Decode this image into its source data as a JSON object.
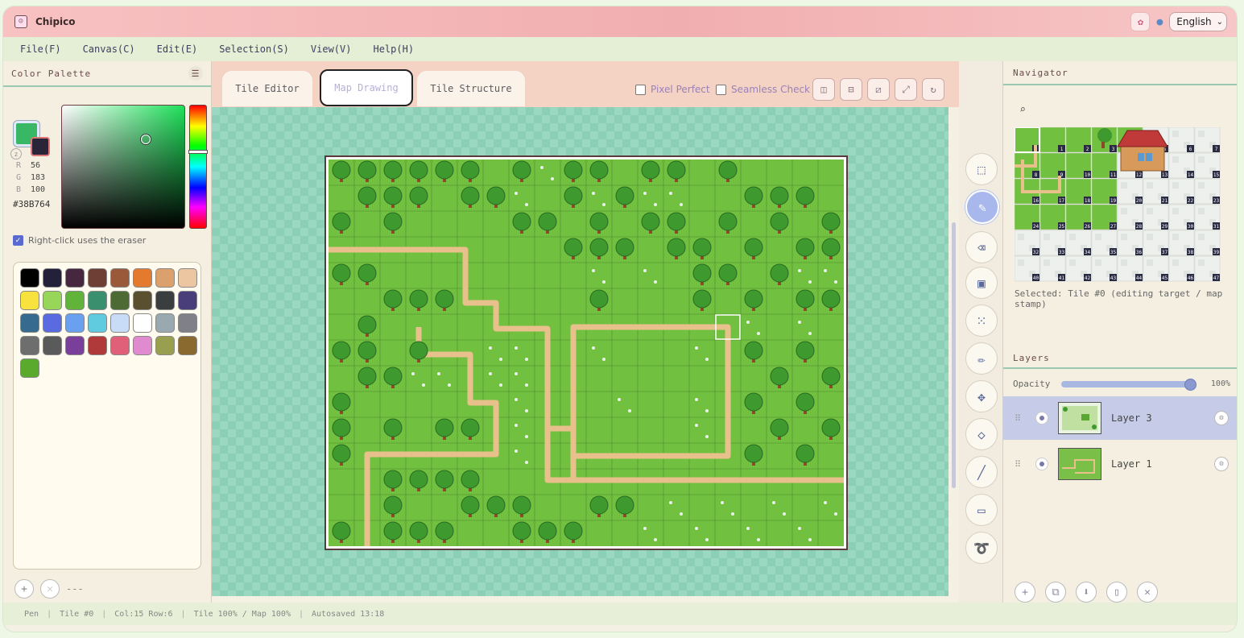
{
  "app": {
    "title": "Chipico",
    "icon": "face-icon",
    "language": "English"
  },
  "menu": [
    "File(F)",
    "Canvas(C)",
    "Edit(E)",
    "Selection(S)",
    "View(V)",
    "Help(H)"
  ],
  "palette_panel": {
    "title": "Color Palette",
    "fg_color": "#38B764",
    "bg_color": "#2a2438",
    "r_label": "R",
    "g_label": "G",
    "b_label": "B",
    "r": "56",
    "g": "183",
    "b": "100",
    "hex": "#38B764",
    "right_click_label": "Right-click uses the eraser",
    "right_click_checked": true,
    "colors": [
      "#000000",
      "#23213a",
      "#47263f",
      "#6e3f34",
      "#9a5a3a",
      "#e37a2e",
      "#dba06c",
      "#ecc6a0",
      "#f7e23e",
      "#98d65a",
      "#62b33a",
      "#3a8f6f",
      "#4e6a34",
      "#5a4f2e",
      "#3a3e3e",
      "#4a3e7a",
      "#366a8e",
      "#5a6ae0",
      "#6aa0f0",
      "#60cadf",
      "#c8dcf7",
      "#ffffff",
      "#9aa8b0",
      "#808088",
      "#6e6e6e",
      "#5a5a5a",
      "#7a3f9a",
      "#b03a3a",
      "#e0607a",
      "#e08ad0",
      "#98a050",
      "#8a6a2e",
      "#5aaa2e"
    ],
    "footer_text": "---"
  },
  "tabs": [
    {
      "label": "Tile Editor",
      "active": false
    },
    {
      "label": "Map Drawing",
      "active": true
    },
    {
      "label": "Tile Structure",
      "active": false
    }
  ],
  "options": {
    "pixel_perfect": "Pixel Perfect",
    "seamless_check": "Seamless Check"
  },
  "view_buttons": [
    "flip-vertical-icon",
    "flip-horizontal-icon",
    "rotate-left-icon",
    "rotate-right-icon",
    "refresh-icon"
  ],
  "tools": [
    "select-rect-icon",
    "pen-icon",
    "eraser-icon",
    "fill-select-icon",
    "dots-select-icon",
    "pencil-icon",
    "move-icon",
    "fill-icon",
    "line-icon",
    "rect-icon",
    "lasso-icon"
  ],
  "active_tool": "pen-icon",
  "navigator": {
    "title": "Navigator",
    "tile_count": 48,
    "selected_info": "Selected: Tile #0 (editing target / map stamp)"
  },
  "layers": {
    "title": "Layers",
    "opacity_label": "Opacity",
    "opacity_value": "100%",
    "opacity": 1.0,
    "items": [
      {
        "name": "Layer 3",
        "selected": true
      },
      {
        "name": "Layer 1",
        "selected": false
      }
    ]
  },
  "status": {
    "tool": "Pen",
    "tile": "Tile #0",
    "pos": "Col:15 Row:6",
    "zoom": "Tile 100% / Map 100%",
    "autosave": "Autosaved 13:18"
  },
  "colors": {
    "grass": "#72c040",
    "path": "#e8c08c",
    "tree": "#3e9a2e",
    "trunk": "#8a4a2a"
  }
}
